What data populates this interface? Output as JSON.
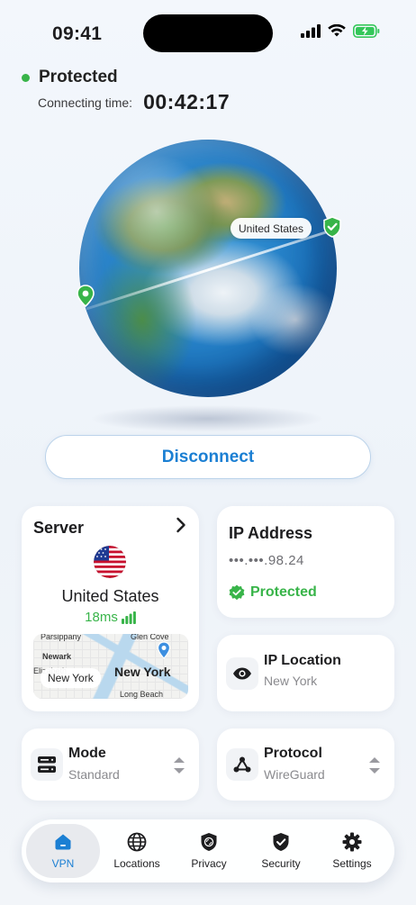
{
  "status_bar": {
    "time": "09:41"
  },
  "connection": {
    "status": "Protected",
    "time_label": "Connecting time:",
    "elapsed": "00:42:17",
    "destination_label": "United States"
  },
  "actions": {
    "disconnect_label": "Disconnect"
  },
  "server": {
    "title": "Server",
    "country": "United States",
    "ping": "18ms",
    "map": {
      "labels": [
        "Parsippany",
        "Glen Cove",
        "Newark",
        "Elizabeth",
        "Long Beach"
      ],
      "city_big": "New York",
      "city_pill": "New York"
    }
  },
  "ip": {
    "title": "IP Address",
    "value": "•••.•••.98.24",
    "status": "Protected"
  },
  "ip_location": {
    "title": "IP Location",
    "value": "New York"
  },
  "mode": {
    "title": "Mode",
    "value": "Standard"
  },
  "protocol": {
    "title": "Protocol",
    "value": "WireGuard"
  },
  "tabs": [
    {
      "label": "VPN",
      "icon": "home-icon"
    },
    {
      "label": "Locations",
      "icon": "globe-icon"
    },
    {
      "label": "Privacy",
      "icon": "privacy-shield-icon"
    },
    {
      "label": "Security",
      "icon": "security-shield-icon"
    },
    {
      "label": "Settings",
      "icon": "gear-icon"
    }
  ],
  "colors": {
    "accent": "#1b7fd3",
    "success": "#38b449"
  }
}
